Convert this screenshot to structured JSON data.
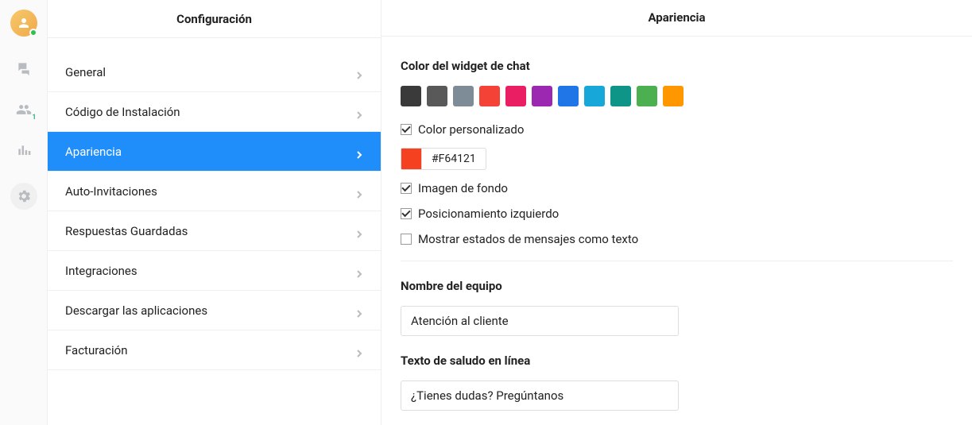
{
  "rail": {
    "contacts_badge": "1"
  },
  "settings": {
    "header": "Configuración",
    "items": [
      {
        "label": "General"
      },
      {
        "label": "Código de Instalación"
      },
      {
        "label": "Apariencia",
        "active": true
      },
      {
        "label": "Auto-Invitaciones"
      },
      {
        "label": "Respuestas Guardadas"
      },
      {
        "label": "Integraciones"
      },
      {
        "label": "Descargar las aplicaciones"
      },
      {
        "label": "Facturación"
      }
    ]
  },
  "main": {
    "header": "Apariencia",
    "widget_color_title": "Color del widget de chat",
    "swatches": [
      "#3a3a3a",
      "#595959",
      "#7d8c96",
      "#f44336",
      "#e91e63",
      "#9c27b0",
      "#2076e6",
      "#17a8d9",
      "#0f9488",
      "#4caf50",
      "#ff9800"
    ],
    "custom_color_checkbox": {
      "label": "Color personalizado",
      "checked": true
    },
    "custom_color_value": "#F64121",
    "bg_image_checkbox": {
      "label": "Imagen de fondo",
      "checked": true
    },
    "left_pos_checkbox": {
      "label": "Posicionamiento izquierdo",
      "checked": true
    },
    "show_states_checkbox": {
      "label": "Mostrar estados de mensajes como texto",
      "checked": false
    },
    "team_name_title": "Nombre del equipo",
    "team_name_value": "Atención al cliente",
    "greeting_title": "Texto de saludo en línea",
    "greeting_value": "¿Tienes dudas? Pregúntanos"
  }
}
